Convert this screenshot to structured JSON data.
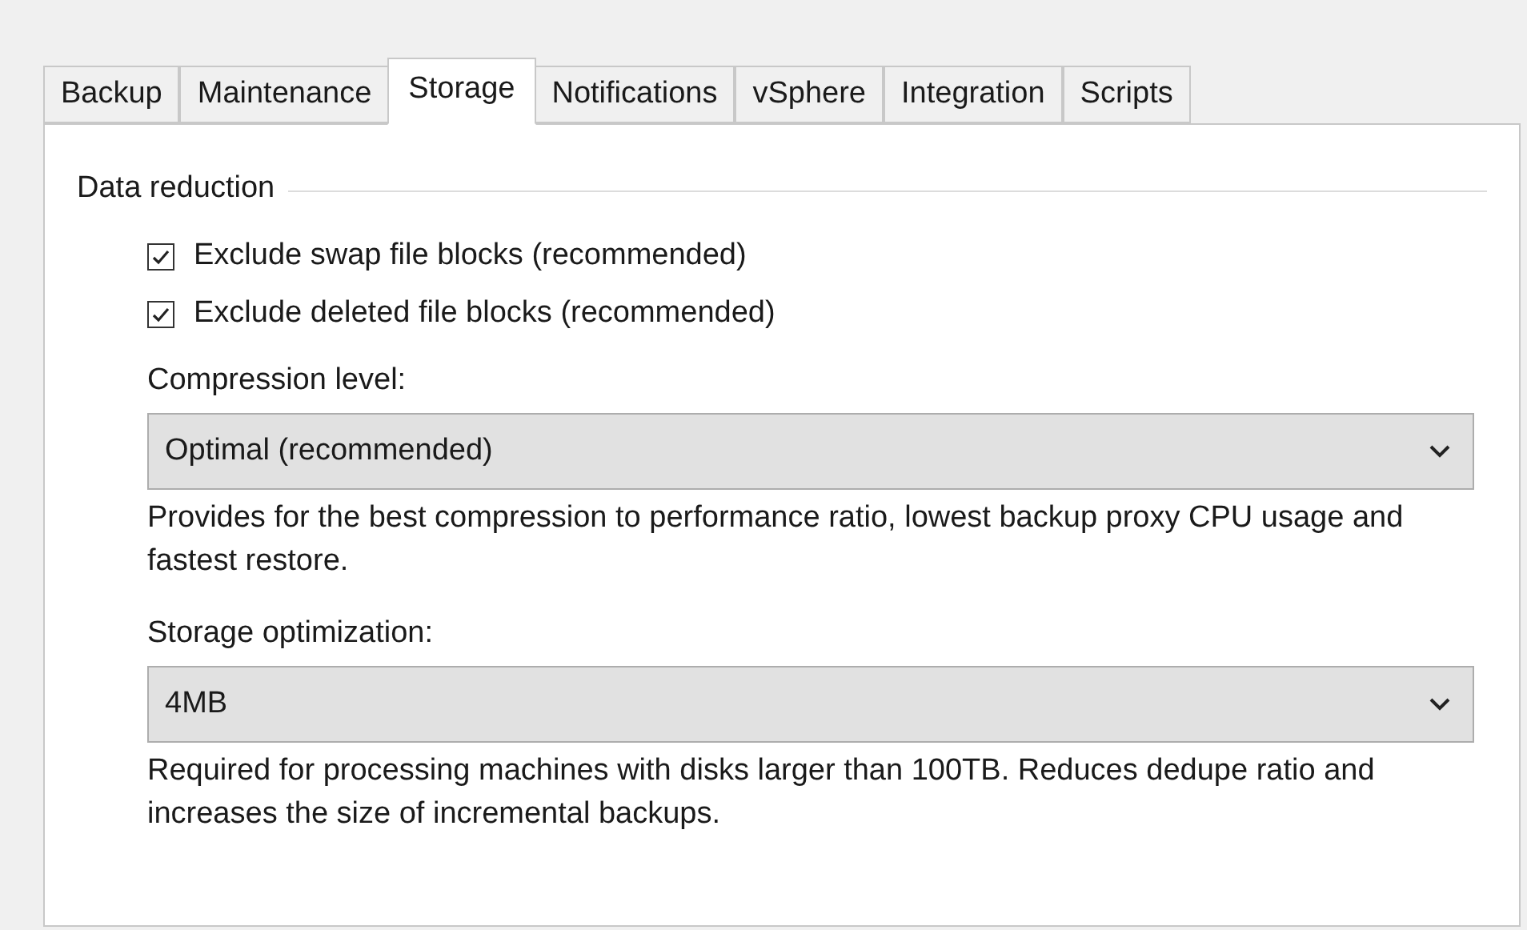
{
  "tabs": [
    {
      "label": "Backup",
      "selected": false
    },
    {
      "label": "Maintenance",
      "selected": false
    },
    {
      "label": "Storage",
      "selected": true
    },
    {
      "label": "Notifications",
      "selected": false
    },
    {
      "label": "vSphere",
      "selected": false
    },
    {
      "label": "Integration",
      "selected": false
    },
    {
      "label": "Scripts",
      "selected": false
    }
  ],
  "group": {
    "title": "Data reduction",
    "checkboxes": [
      {
        "label": "Exclude swap file blocks (recommended)",
        "checked": true
      },
      {
        "label": "Exclude deleted file blocks (recommended)",
        "checked": true
      }
    ],
    "dropdowns": [
      {
        "label": "Compression level:",
        "value": "Optimal (recommended)",
        "description": "Provides for the best compression to performance ratio, lowest backup proxy CPU usage and fastest restore."
      },
      {
        "label": "Storage optimization:",
        "value": "4MB",
        "description": "Required for processing machines with disks larger than 100TB. Reduces dedupe ratio and increases the size of incremental backups."
      }
    ]
  }
}
